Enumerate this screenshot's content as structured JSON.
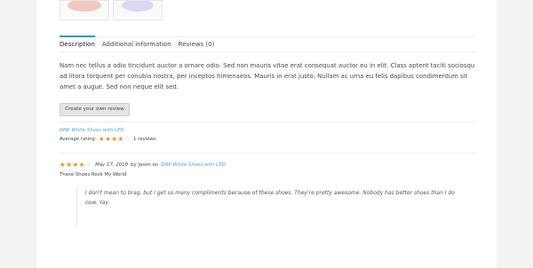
{
  "tabs": [
    {
      "label": "Description",
      "active": true
    },
    {
      "label": "Additional information",
      "active": false
    },
    {
      "label": "Reviews (0)",
      "active": false
    }
  ],
  "description": "Nam nec tellus a odio tincidunt auctor a ornare odio. Sed non mauris vitae erat consequat auctor eu in elit. Class aptent taciti sociosqu ad litora torquent per conubia nostra, per inceptos himenaeos. Mauris in erat justo. Nullam ac urna eu felis dapibus condimentum sit amet a augue. Sed non neque elit sed.",
  "review_button_label": "Create your own review",
  "summary": {
    "product_link": "DNK White Shoes with LED",
    "average_label": "Average rating",
    "rating": 4,
    "max_rating": 5,
    "count_text": "1 reviews"
  },
  "review": {
    "rating": 4,
    "max_rating": 5,
    "date": "May 17, 2018",
    "by_text": "by Jason on",
    "product_link": "DNK White Shoes with LED",
    "title": "These Shoes Rock My World",
    "body": "I don't mean to brag, but I get so many compliments because of these shoes. They're pretty awesome. Nobody has better shoes than I do now. Yay."
  },
  "colors": {
    "accent": "#2a96d4",
    "star": "#f08c24",
    "link": "#48a8dc"
  }
}
